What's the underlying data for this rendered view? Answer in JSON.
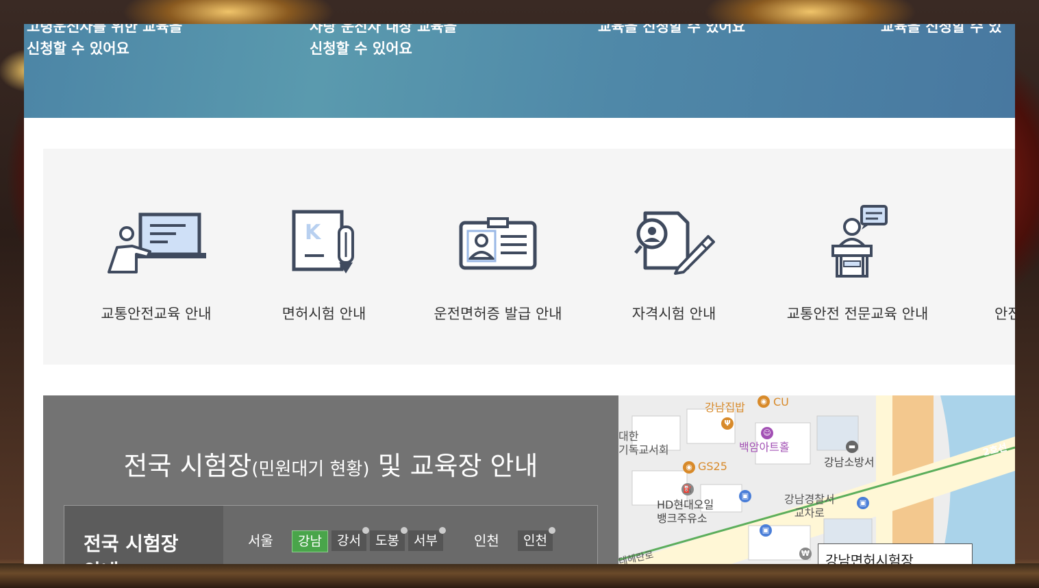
{
  "hero": {
    "items": [
      {
        "text": "고령운전자를 위한 교육을\n신청할 수 있어요"
      },
      {
        "text": "사랑 운전자 내장 교육을\n신청할 수 있어요"
      },
      {
        "text": "교육을 신청할 수 있어요"
      },
      {
        "text": "교육을 신청할 수 있"
      }
    ]
  },
  "quick_menu": {
    "items": [
      {
        "label": "교통안전교육 안내",
        "icon": "teacher-board-icon"
      },
      {
        "label": "면허시험 안내",
        "icon": "document-pen-icon"
      },
      {
        "label": "운전면허증 발급 안내",
        "icon": "id-card-icon"
      },
      {
        "label": "자격시험 안내",
        "icon": "certificate-pen-icon"
      },
      {
        "label": "교통안전 전문교육 안내",
        "icon": "podium-speaker-icon"
      },
      {
        "label": "안전",
        "icon": ""
      }
    ]
  },
  "exam": {
    "title_main": "전국 시험장",
    "title_sub": "(민원대기 현황)",
    "title_rest": " 및 교육장 안내",
    "box_heading": "전국 시험장\n안내",
    "regions": [
      {
        "name": "서울",
        "chips": [
          "강남",
          "강서",
          "도봉",
          "서부"
        ],
        "active": "강남"
      },
      {
        "name": "인천",
        "chips": [
          "인천"
        ]
      }
    ]
  },
  "map": {
    "labels": [
      {
        "text": "강남집밥",
        "color": "orange"
      },
      {
        "text": "CU",
        "color": "orange"
      },
      {
        "text": "대한\n기독교서회",
        "color": "default"
      },
      {
        "text": "백암아트홀",
        "color": "purple"
      },
      {
        "text": "GS25",
        "color": "orange"
      },
      {
        "text": "강남소방서",
        "color": "default"
      },
      {
        "text": "HD현대오일\n뱅크주유소",
        "color": "default"
      },
      {
        "text": "강남경찰서\n교차로",
        "color": "default"
      },
      {
        "text": "2호선",
        "color": "green"
      },
      {
        "text": "테헤란로",
        "color": "default"
      }
    ],
    "callout": "강남면허시험장"
  }
}
